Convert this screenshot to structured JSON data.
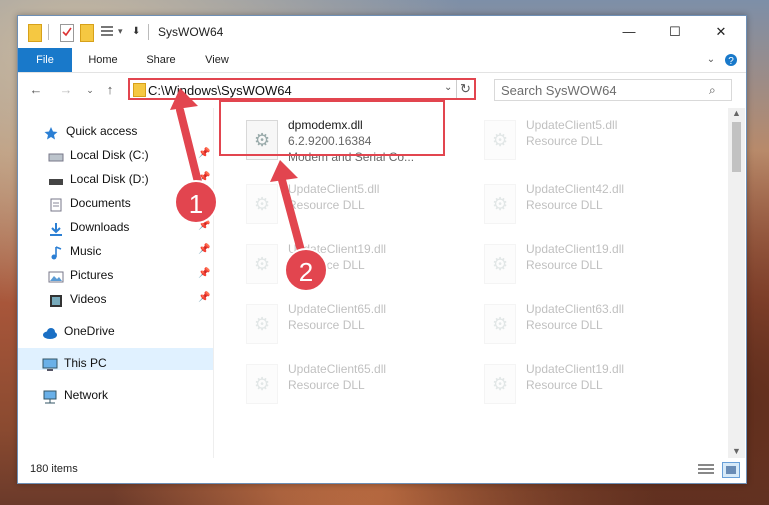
{
  "window": {
    "title": "SysWOW64",
    "controls": {
      "minimize": "—",
      "maximize": "☐",
      "close": "✕"
    }
  },
  "ribbon": {
    "tabs": [
      "File",
      "Home",
      "Share",
      "View"
    ]
  },
  "nav": {
    "address": "C:\\Windows\\SysWOW64",
    "search_placeholder": "Search SysWOW64"
  },
  "sidebar": {
    "items": [
      {
        "label": "Quick access",
        "icon": "star-icon"
      },
      {
        "label": "Local Disk (C:)",
        "icon": "drive-icon",
        "pinned": true
      },
      {
        "label": "Local Disk (D:)",
        "icon": "drive-icon",
        "pinned": true
      },
      {
        "label": "Documents",
        "icon": "documents-icon",
        "pinned": true
      },
      {
        "label": "Downloads",
        "icon": "download-icon",
        "pinned": true
      },
      {
        "label": "Music",
        "icon": "music-icon",
        "pinned": true
      },
      {
        "label": "Pictures",
        "icon": "pictures-icon",
        "pinned": true
      },
      {
        "label": "Videos",
        "icon": "videos-icon",
        "pinned": true
      },
      {
        "label": "OneDrive",
        "icon": "cloud-icon"
      },
      {
        "label": "This PC",
        "icon": "computer-icon",
        "selected": true
      },
      {
        "label": "Network",
        "icon": "network-icon"
      }
    ]
  },
  "files": [
    {
      "name": "dpmodemx.dll",
      "version": "6.2.9200.16384",
      "desc": "Modem and Serial Co..."
    },
    {
      "name": "UpdateClient5.dll",
      "desc": "Resource DLL"
    },
    {
      "name": "UpdateClient5.dll",
      "desc": "Resource DLL"
    },
    {
      "name": "UpdateClient42.dll",
      "desc": "Resource DLL"
    },
    {
      "name": "UpdateClient19.dll",
      "desc": "Resource DLL"
    },
    {
      "name": "UpdateClient19.dll",
      "desc": "Resource DLL"
    },
    {
      "name": "UpdateClient65.dll",
      "desc": "Resource DLL"
    },
    {
      "name": "UpdateClient63.dll",
      "desc": "Resource DLL"
    },
    {
      "name": "UpdateClient65.dll",
      "desc": "Resource DLL"
    },
    {
      "name": "UpdateClient19.dll",
      "desc": "Resource DLL"
    }
  ],
  "status": {
    "item_count": "180 items"
  },
  "annotations": {
    "badge1": "1",
    "badge2": "2",
    "color": "#e2454f"
  }
}
